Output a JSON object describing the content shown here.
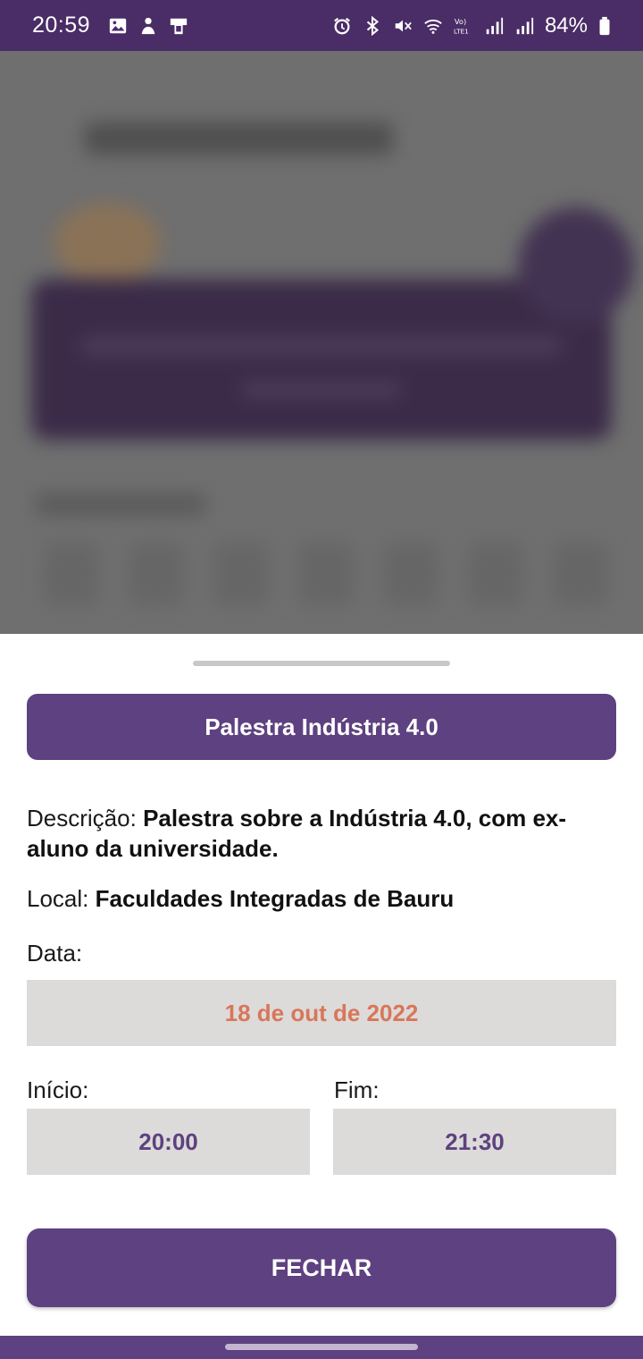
{
  "status_bar": {
    "time": "20:59",
    "battery": "84%",
    "left_icons": [
      "gallery-icon",
      "notification-app-icon",
      "payment-app-icon"
    ],
    "right_icons": [
      "alarm-icon",
      "bluetooth-icon",
      "mute-icon",
      "wifi-icon",
      "volte-icon",
      "signal-icon",
      "signal-icon",
      "battery-icon"
    ]
  },
  "event": {
    "title": "Palestra Indústria 4.0",
    "description_label": "Descrição:",
    "description_value": "Palestra sobre a Indústria 4.0, com ex-aluno da universidade.",
    "location_label": "Local:",
    "location_value": "Faculdades Integradas de Bauru",
    "date_label": "Data:",
    "date_value": "18 de out de 2022",
    "start_label": "Início:",
    "start_value": "20:00",
    "end_label": "Fim:",
    "end_value": "21:30"
  },
  "actions": {
    "close_label": "FECHAR"
  },
  "colors": {
    "primary": "#5e4180",
    "status_bar": "#4a2c66",
    "date_text": "#d97659",
    "field_bg": "#dcdbda"
  }
}
